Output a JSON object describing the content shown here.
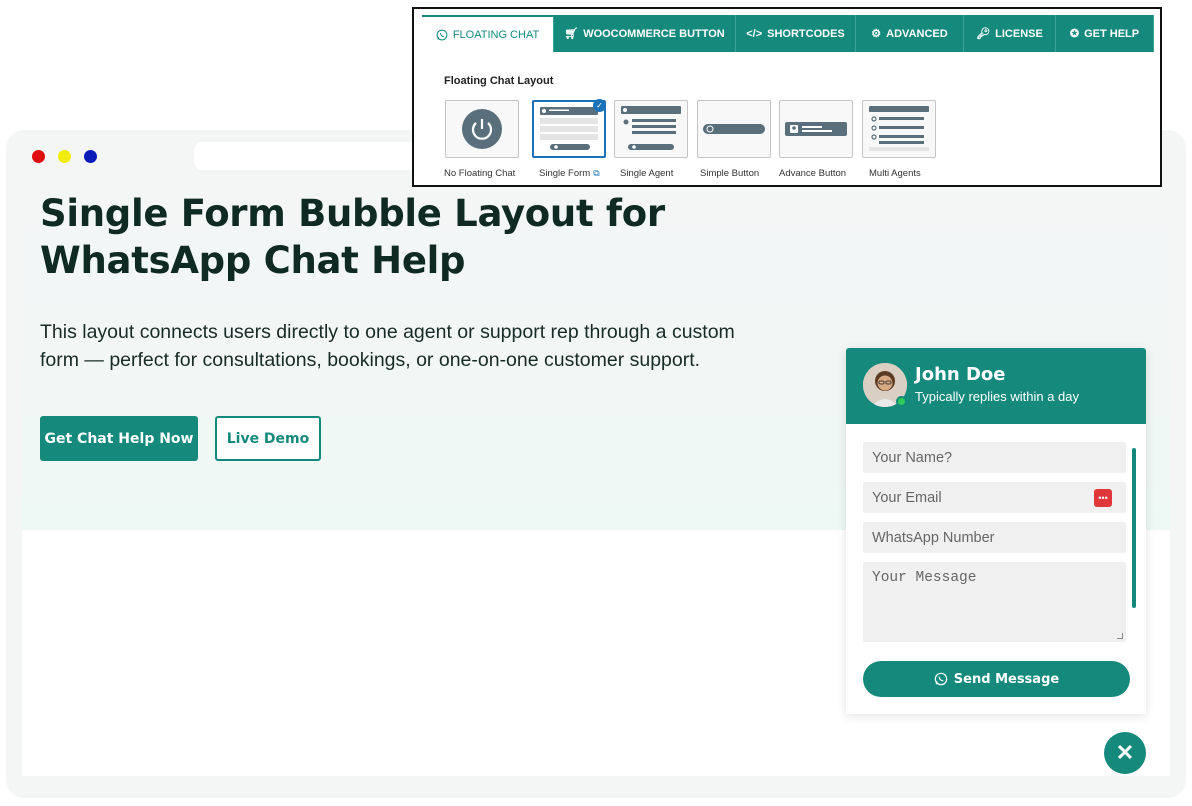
{
  "hero": {
    "title_line1": "Single Form Bubble Layout for",
    "title_line2": "WhatsApp Chat Help",
    "description_line1": "This layout connects users directly to one agent or support rep through a custom",
    "description_line2": "form — perfect for consultations, bookings, or one-on-one customer support.",
    "primary_cta": "Get Chat Help Now",
    "secondary_cta": "Live Demo"
  },
  "browser": {
    "dot_colors": [
      "#e00d0d",
      "#f1ec0b",
      "#0a1bb8"
    ]
  },
  "chat": {
    "agent_name": "John Doe",
    "agent_status": "Typically replies within a day",
    "name_placeholder": "Your Name?",
    "email_placeholder": "Your Email",
    "whatsapp_placeholder": "WhatsApp Number",
    "message_placeholder": "Your Message",
    "send_label": "Send Message",
    "close_label": "✕",
    "accent_color": "#158a7c"
  },
  "settings": {
    "tabs": [
      {
        "label": "FLOATING CHAT",
        "icon": "whatsapp-icon"
      },
      {
        "label": "WOOCOMMERCE BUTTON",
        "icon": "cart-icon"
      },
      {
        "label": "SHORTCODES",
        "icon": "code-icon"
      },
      {
        "label": "ADVANCED",
        "icon": "gears-icon"
      },
      {
        "label": "LICENSE",
        "icon": "key-icon"
      },
      {
        "label": "GET HELP",
        "icon": "lifebuoy-icon"
      }
    ],
    "active_tab": "FLOATING CHAT",
    "section_label": "Floating Chat Layout",
    "layouts": [
      {
        "label": "No Floating Chat",
        "icon": "power-icon"
      },
      {
        "label": "Single Form",
        "icon": "form-layout-icon"
      },
      {
        "label": "Single Agent",
        "icon": "agent-layout-icon"
      },
      {
        "label": "Simple Button",
        "icon": "simple-button-icon"
      },
      {
        "label": "Advance Button",
        "icon": "advance-button-icon"
      },
      {
        "label": "Multi Agents",
        "icon": "multi-agents-icon"
      }
    ],
    "selected_layout": "Single Form"
  }
}
